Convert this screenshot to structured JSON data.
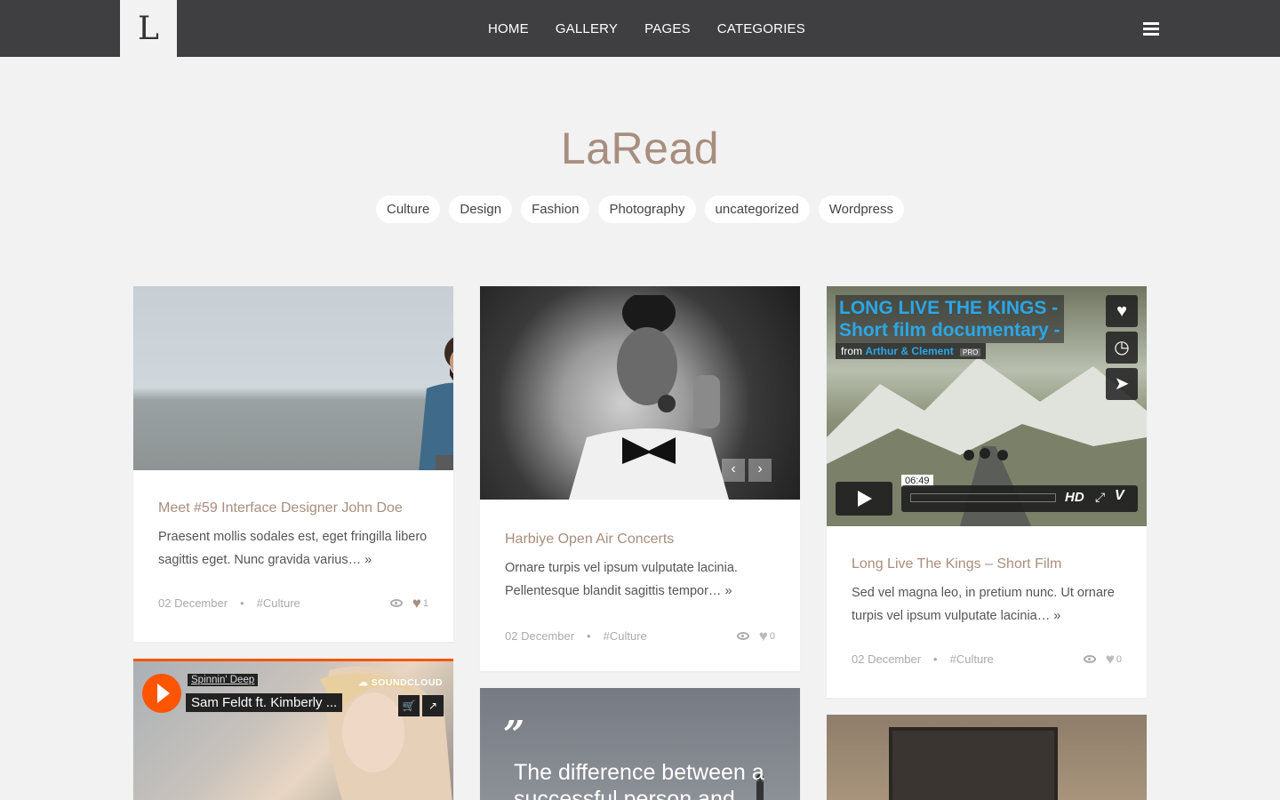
{
  "header": {
    "logo": "L",
    "nav": [
      "HOME",
      "GALLERY",
      "PAGES",
      "CATEGORIES"
    ]
  },
  "site": {
    "title": "LaRead",
    "categories": [
      "Culture",
      "Design",
      "Fashion",
      "Photography",
      "uncategorized",
      "Wordpress"
    ]
  },
  "posts": [
    {
      "title": "Meet #59 Interface Designer John Doe",
      "excerpt": "Praesent mollis sodales est, eget fringilla libero sagittis eget. Nunc gravida varius… »",
      "date": "02 December",
      "category": "#Culture",
      "likes": "1"
    },
    {
      "title": "Harbiye Open Air Concerts",
      "excerpt": "Ornare turpis vel ipsum vulputate lacinia. Pellentesque blandit sagittis tempor… »",
      "date": "02 December",
      "category": "#Culture",
      "likes": "0"
    },
    {
      "title": "Long Live The Kings – Short Film",
      "excerpt": "Sed vel magna leo, in pretium nunc. Ut ornare turpis vel ipsum vulputate lacinia… »",
      "date": "02 December",
      "category": "#Culture",
      "likes": "0"
    }
  ],
  "slider": {
    "prev": "‹",
    "next": "›"
  },
  "video": {
    "title_line1": "LONG LIVE THE KINGS -",
    "title_line2": "Short film documentary -",
    "from_label": "from",
    "author": "Arthur & Clement",
    "badge": "PRO",
    "duration": "06:49",
    "hd": "HD",
    "vimeo": "V",
    "icons": [
      "heart-icon",
      "clock-icon",
      "send-icon"
    ]
  },
  "soundcloud": {
    "user": "Spinnin' Deep",
    "track": "Sam Feldt ft. Kimberly ...",
    "brand": "SOUNDCLOUD"
  },
  "quote": {
    "mark": "”",
    "text": "The difference between a successful person and"
  },
  "colors": {
    "topbar": "#3f3f42",
    "accent": "#a88e7e",
    "soundcloud": "#ff5500",
    "vimeo_blue": "#2aa7e8"
  }
}
